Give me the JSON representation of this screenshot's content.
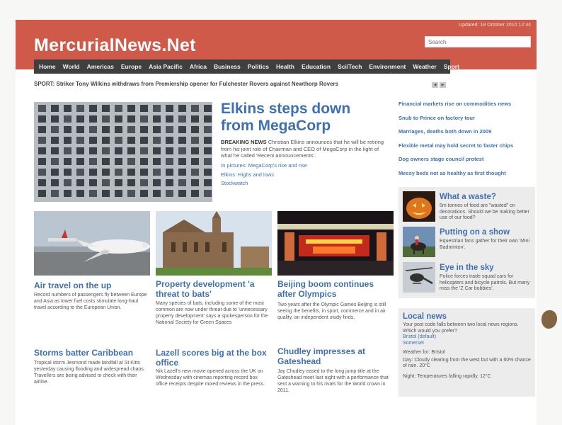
{
  "header": {
    "updated": "Updated: 19 October 2010 12:34",
    "site_name": "MercurialNews.Net",
    "search_placeholder": "Search"
  },
  "nav": [
    "Home",
    "World",
    "Americas",
    "Europe",
    "Asia Pacific",
    "Africa",
    "Business",
    "Politics",
    "Health",
    "Education",
    "Sci/Tech",
    "Environment",
    "Weather",
    "Sport"
  ],
  "ticker": {
    "text": "SPORT: Striker Tony Wilkins withdraws from Premiership opener for Fulchester Rovers against Newthorp Rovers",
    "prev_icon": "chevron-left-icon",
    "next_icon": "chevron-right-icon"
  },
  "lead": {
    "title": "Elkins steps down from MegaCorp",
    "label": "BREAKING NEWS",
    "summary": "Christian Elkins announces that he will be retiring from his joint role of Chairman and CEO of MegaCorp in the light of what he called 'Recent announcements'.",
    "links": [
      "In pictures: MegaCorp's rise and rise",
      "Elkins: Highs and lows",
      "Stockwatch"
    ]
  },
  "headlines": [
    "Financial markets rise on commodities news",
    "Snub to Prince on factory tour",
    "Marriages, deaths both down in 2009",
    "Flexible metal may hold secret to faster chips",
    "Dog owners stage council protest",
    "Messy beds not as healthy as first thought"
  ],
  "side_stories": [
    {
      "title": "What a waste?",
      "text": "5m tonnes of food are \"wasted\" on decorations. Should we be making better use of our food?",
      "icon": "pumpkin-icon"
    },
    {
      "title": "Putting on a show",
      "text": "Equestrian fans gather for their own 'Mini Badminton'.",
      "icon": "horse-rider-icon"
    },
    {
      "title": "Eye in the sky",
      "text": "Police forces trade squad cars for helicopters and bicycle patrols. But many miss the 'Z Car bobbies'.",
      "icon": "helicopter-icon"
    }
  ],
  "local": {
    "title": "Local news",
    "text": "Your post code falls between two local news regions. Which would you prefer?",
    "options": [
      "Bristol (default)",
      "Somerset"
    ],
    "weather_label": "Weather for: Bristol",
    "day": "Day: Cloudy clearing from the west but with a 60% chance of rain. 20°C",
    "night": "Night: Temperatures falling rapidly. 12°C"
  },
  "stories": [
    {
      "title": "Air travel on the up",
      "text": "Record numbers of passengers fly between Europe and Asia as lower fuel costs stimulate long-haul travel according to the European Union."
    },
    {
      "title": "Property development 'a threat to bats'",
      "text": "Many species of bats, including some of the most common are now under threat due to 'unnecessary property development' says a spokesperson for the National Society for Green Spaces"
    },
    {
      "title": "Beijing boom continues after Olympics",
      "text": "Two years after the Olympic Games Beijing is still seeing the benefits, in sport, commerce and in air quality, an independent study finds."
    },
    {
      "title": "Storms batter Caribbean",
      "text": "Tropical storm Jesmond made landfall at St Kitts yesterday causing flooding and widespread chaos. Travellers are being advised to check with their airline."
    },
    {
      "title": "Lazell scores big at the box office",
      "text": "Nik Lazell's new movie opened across the UK on Wednesday with cinemas reporting record box office receipts despite mixed reviews in the press."
    },
    {
      "title": "Chudley impresses at Gateshead",
      "text": "Jay Chudley eased to the long jump title at the Gateshead meet last night with a performance that sent a warning to his rivals for the World crown in 2011."
    }
  ]
}
